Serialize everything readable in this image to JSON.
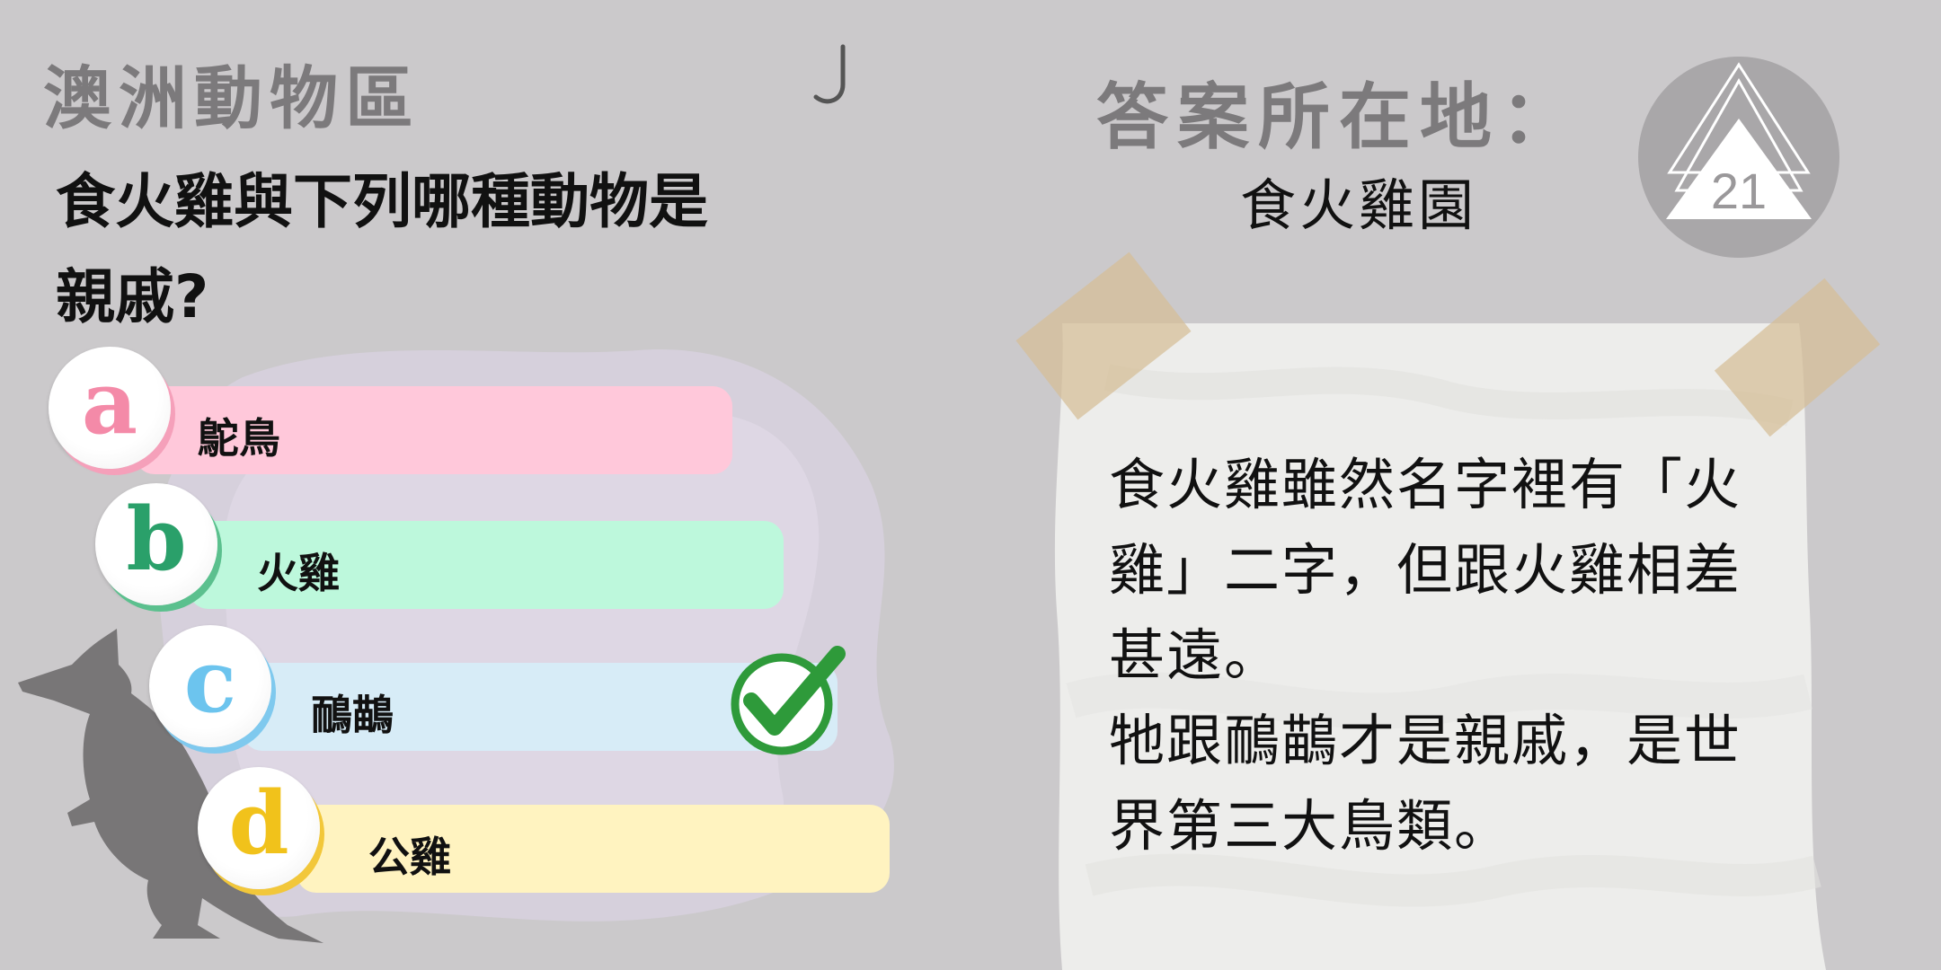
{
  "category": "澳洲動物區",
  "question": {
    "line1": "食火雞與下列哪種動物是",
    "line2": "親戚?"
  },
  "options": [
    {
      "letter": "a",
      "label": "鴕鳥",
      "bar_color": "#ffc8da",
      "letter_color": "#f48aa8",
      "shade_color": "#f5a0ba"
    },
    {
      "letter": "b",
      "label": "火雞",
      "bar_color": "#bdf8dc",
      "letter_color": "#2aa06a",
      "shade_color": "#5bc08e"
    },
    {
      "letter": "c",
      "label": "鴯鶓",
      "bar_color": "#d7ecf7",
      "letter_color": "#6cc4ee",
      "shade_color": "#7fc9ee"
    },
    {
      "letter": "d",
      "label": "公雞",
      "bar_color": "#fff3c0",
      "letter_color": "#f1c21b",
      "shade_color": "#f2c73a"
    }
  ],
  "correct_option": "c",
  "answer": {
    "title": "答案所在地：",
    "place": "食火雞園",
    "lines": [
      "食火雞雖然名字裡有「火",
      "雞」二字，但跟火雞相差",
      "甚遠。",
      "牠跟鴯鶓才是親戚，是世",
      "界第三大鳥類。"
    ]
  },
  "badge_number": "21",
  "icons": {
    "check": "check-circle-icon",
    "kangaroo": "kangaroo-silhouette",
    "hook": "hook-icon",
    "badge": "triangle-logo-badge"
  }
}
